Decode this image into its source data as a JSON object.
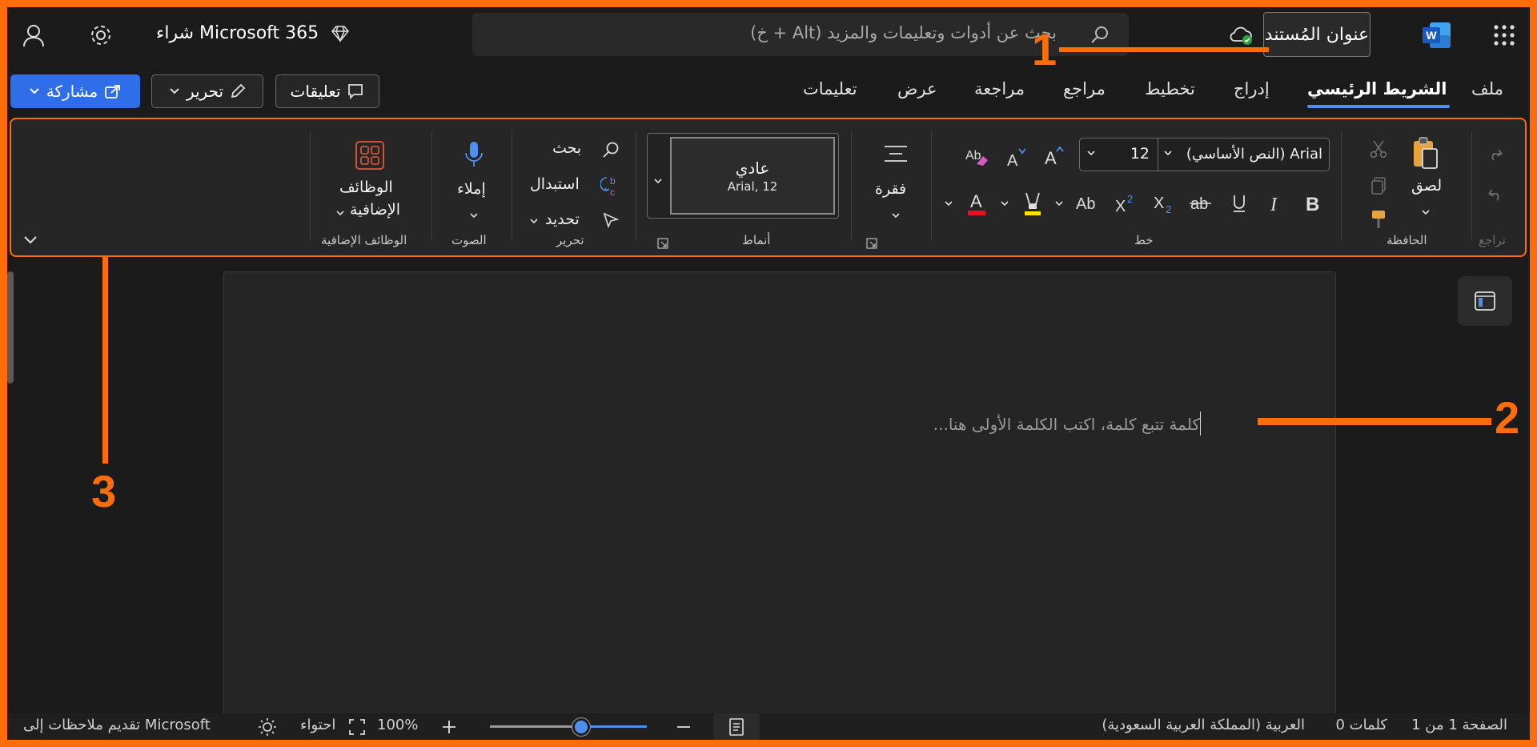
{
  "topbar": {
    "search_placeholder": "بحث عن أدوات وتعليمات والمزيد (Alt + خ)",
    "document_title": "عنوان المُستند",
    "buy_label": "شراء Microsoft 365"
  },
  "tabs": [
    "ملف",
    "الشريط الرئيسي",
    "إدراج",
    "تخطيط",
    "مراجع",
    "مراجعة",
    "عرض",
    "تعليمات"
  ],
  "actions": {
    "comments": "تعليقات",
    "edit": "تحرير",
    "share": "مشاركة"
  },
  "ribbon": {
    "undo_group": "تراجع",
    "clipboard": {
      "paste": "لصق",
      "group": "الحافظة"
    },
    "font": {
      "name": "Arial (النص الأساسي)",
      "size": "12",
      "group": "خط"
    },
    "paragraph": {
      "label": "فقرة"
    },
    "styles": {
      "name": "عادي",
      "detail": "Arial, 12",
      "group": "أنماط"
    },
    "editing": {
      "find": "بحث",
      "replace": "استبدال",
      "select": "تحديد",
      "group": "تحرير"
    },
    "voice": {
      "dictate": "إملاء",
      "group": "الصوت"
    },
    "addins": {
      "label_line1": "الوظائف",
      "label_line2": "الإضافية",
      "group": "الوظائف الإضافية"
    }
  },
  "document": {
    "placeholder": "كلمة تتبع كلمة، اكتب الكلمة الأولى هنا..."
  },
  "status": {
    "page": "الصفحة 1 من 1",
    "words": "0 كلمات",
    "language": "العربية (المملكة العربية السعودية)",
    "zoom": "100%",
    "fit": "احتواء",
    "feedback": "تقديم ملاحظات إلى Microsoft",
    "zoom_level": 0.58
  },
  "annotations": [
    "1",
    "2",
    "3"
  ],
  "colors": {
    "accent": "#ff6c0a",
    "share": "#2f6ee8",
    "word": "#185abd",
    "font_color": "#e81123",
    "highlight": "#ffe600"
  }
}
